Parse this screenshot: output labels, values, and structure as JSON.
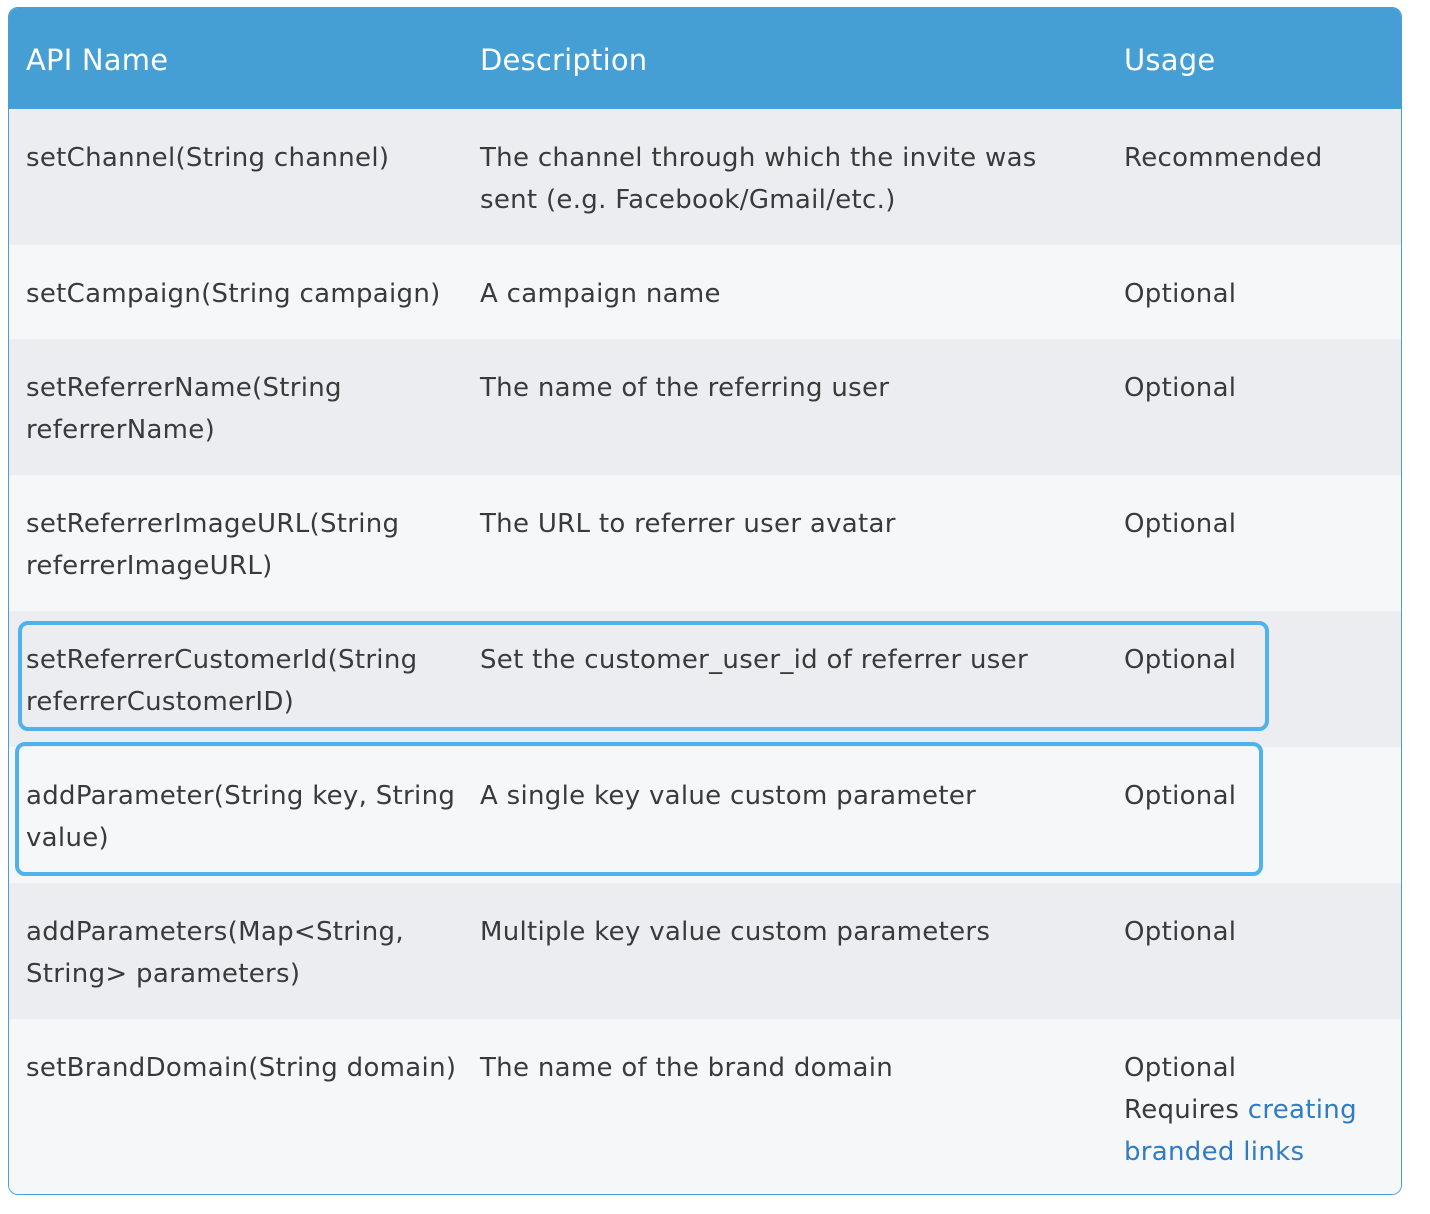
{
  "header": {
    "col1": "API Name",
    "col2": "Description",
    "col3": "Usage"
  },
  "rows": [
    {
      "api": "setChannel(String channel)",
      "description": "The channel through which the invite was sent (e.g. Facebook/Gmail/etc.)",
      "usage": "Recommended"
    },
    {
      "api": "setCampaign(String campaign)",
      "description": "A campaign name",
      "usage": "Optional"
    },
    {
      "api": "setReferrerName(String referrerName)",
      "description": "The name of the referring user",
      "usage": "Optional"
    },
    {
      "api": "setReferrerImageURL(String referrerImageURL)",
      "description": "The URL to referrer user avatar",
      "usage": "Optional"
    },
    {
      "api": "setReferrerCustomerId(String referrerCustomerID)",
      "description": "Set the customer_user_id of referrer user",
      "usage": "Optional"
    },
    {
      "api": "addParameter(String key, String value)",
      "description": "A single key value custom parameter",
      "usage": "Optional"
    },
    {
      "api": "addParameters(Map<String, String> parameters)",
      "description": "Multiple key value custom parameters",
      "usage": "Optional"
    },
    {
      "api": "setBrandDomain(String domain)",
      "description": "The name of the brand domain",
      "usage": "Optional",
      "usage_note": "Requires",
      "usage_link": "creating branded links"
    }
  ],
  "colors": {
    "header_bg": "#459fd4",
    "highlight": "#4fb2ef",
    "link": "#2f7cc4"
  }
}
